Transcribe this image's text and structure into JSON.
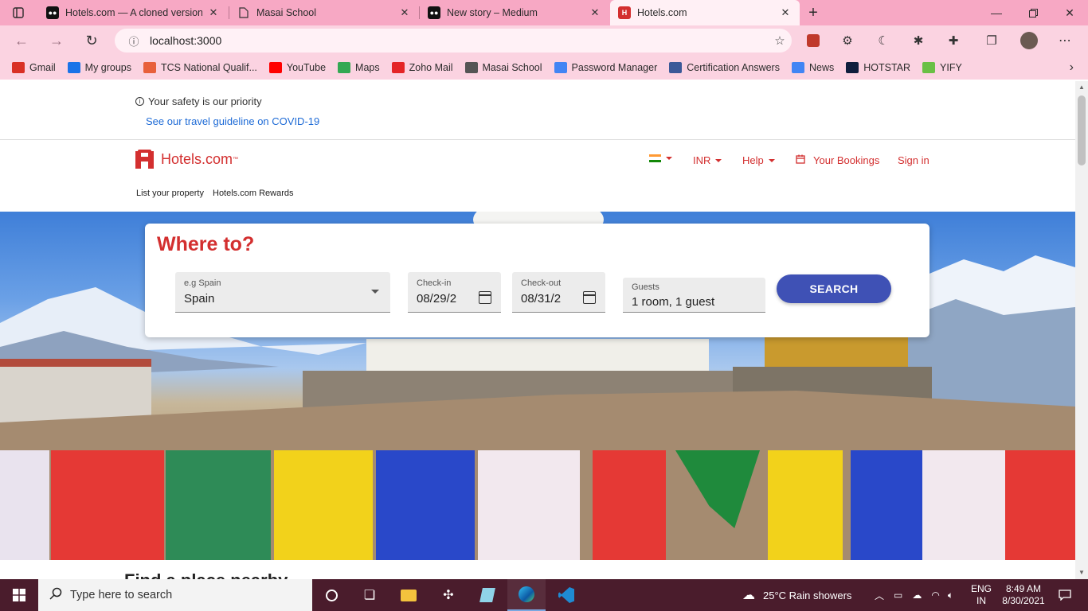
{
  "browser": {
    "tabs": [
      {
        "title": "Hotels.com — A cloned version...",
        "icon": "medium-icon",
        "active": false
      },
      {
        "title": "Masai School",
        "icon": "page-icon",
        "active": false
      },
      {
        "title": "New story – Medium",
        "icon": "medium-icon",
        "active": false
      },
      {
        "title": "Hotels.com",
        "icon": "hotels-icon",
        "active": true
      }
    ],
    "new_tab": "+",
    "address": "localhost:3000",
    "bookmarks": [
      {
        "label": "Gmail",
        "icon": "gmail-icon",
        "color": "#d93025"
      },
      {
        "label": "My groups",
        "icon": "groups-icon",
        "color": "#1a73e8"
      },
      {
        "label": "TCS National Qualif...",
        "icon": "tcs-icon",
        "color": "#e8603c"
      },
      {
        "label": "YouTube",
        "icon": "youtube-icon",
        "color": "#ff0000"
      },
      {
        "label": "Maps",
        "icon": "maps-icon",
        "color": "#34a853"
      },
      {
        "label": "Zoho Mail",
        "icon": "zoho-icon",
        "color": "#e42527"
      },
      {
        "label": "Masai School",
        "icon": "page-icon",
        "color": "#555555"
      },
      {
        "label": "Password Manager",
        "icon": "google-icon",
        "color": "#4285f4"
      },
      {
        "label": "Certification Answers",
        "icon": "cert-icon",
        "color": "#3b5998"
      },
      {
        "label": "News",
        "icon": "news-icon",
        "color": "#4285f4"
      },
      {
        "label": "HOTSTAR",
        "icon": "hotstar-icon",
        "color": "#0f1e3d"
      },
      {
        "label": "YIFY",
        "icon": "yify-icon",
        "color": "#6ac045"
      }
    ]
  },
  "site": {
    "safety_text": "Your safety is our priority",
    "covid_link": "See our travel guideline on COVID-19",
    "brand": "Hotels.com",
    "brand_tm": "™",
    "nav": {
      "currency": "INR",
      "help": "Help",
      "bookings": "Your Bookings",
      "signin": "Sign in"
    },
    "subnav": {
      "list_property": "List your property",
      "rewards": "Hotels.com Rewards"
    },
    "search": {
      "heading": "Where to?",
      "destination_label": "e.g Spain",
      "destination_value": "Spain",
      "checkin_label": "Check-in",
      "checkin_value": "08/29/2",
      "checkout_label": "Check-out",
      "checkout_value": "08/31/2",
      "guests_label": "Guests",
      "guests_value": "1 room, 1 guest",
      "button": "SEARCH"
    },
    "below_fold_heading": "Find a place nearby",
    "colors": {
      "brand_red": "#d32f2f",
      "button_blue": "#3f51b5",
      "link_blue": "#1e6bd6"
    }
  },
  "taskbar": {
    "search_placeholder": "Type here to search",
    "weather": "25°C  Rain showers",
    "lang_top": "ENG",
    "lang_bottom": "IN",
    "time": "8:49 AM",
    "date": "8/30/2021"
  }
}
